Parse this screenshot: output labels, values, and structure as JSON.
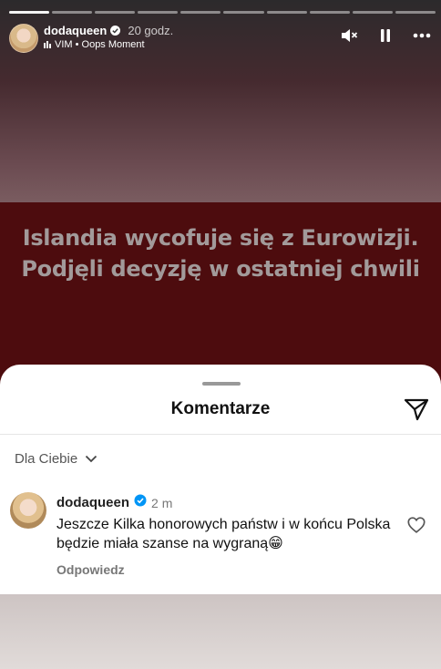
{
  "story": {
    "progress_segments": 10,
    "active_segment": 0,
    "username": "dodaqueen",
    "time": "20 godz.",
    "music": "VIM • Oops Moment",
    "headline_line1": "Islandia wycofuje się z Eurowizji.",
    "headline_line2": "Podjęli decyzję w ostatniej chwili",
    "icons": [
      "mute-icon",
      "pause-icon",
      "more-icon"
    ]
  },
  "comments_sheet": {
    "title": "Komentarze",
    "filter_label": "Dla Ciebie",
    "comments": [
      {
        "username": "dodaqueen",
        "verified": true,
        "time": "2 m",
        "text": "Jeszcze Kilka honorowych państw i w końcu Polska będzie miała szanse na wygraną😁",
        "reply_label": "Odpowiedz"
      }
    ]
  },
  "colors": {
    "headline_bg": "#4d0c0e",
    "verified_blue": "#0095f6"
  }
}
